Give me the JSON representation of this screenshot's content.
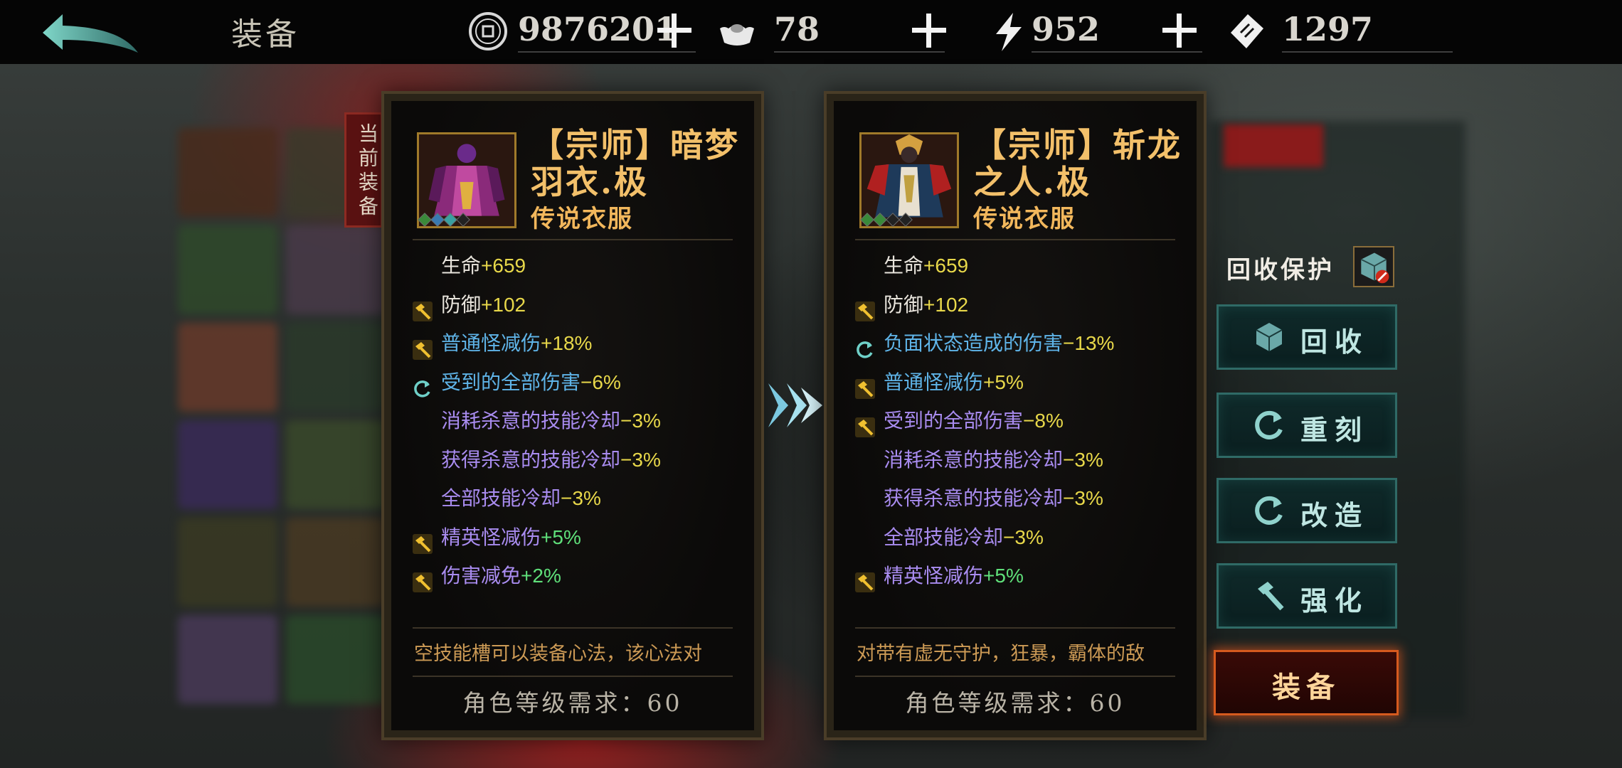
{
  "header": {
    "title": "装备",
    "resources": [
      {
        "icon": "coin-icon",
        "value": "9876201"
      },
      {
        "icon": "silver-ingot-icon",
        "value": "78"
      },
      {
        "icon": "stamina-lightning-icon",
        "value": "952"
      },
      {
        "icon": "ticket-icon",
        "value": "1297"
      }
    ]
  },
  "current_tag": "当前装备",
  "cards": [
    {
      "name": "【宗师】暗梦羽衣.极",
      "type": "传说衣服",
      "stats": [
        {
          "icon": "",
          "label": "生命",
          "value": "+659",
          "label_color": "white",
          "value_color": "yellow"
        },
        {
          "icon": "hammer-icon",
          "label": "防御",
          "value": "+102",
          "label_color": "white",
          "value_color": "yellow"
        },
        {
          "icon": "hammer-icon",
          "label": "普通怪减伤",
          "value": "+18%",
          "label_color": "blue",
          "value_color": "yellow"
        },
        {
          "icon": "refresh-icon",
          "label": "受到的全部伤害",
          "value": "−6%",
          "label_color": "blue",
          "value_color": "yellow"
        },
        {
          "icon": "",
          "label": "消耗杀意的技能冷却",
          "value": "−3%",
          "label_color": "purple",
          "value_color": "yellow"
        },
        {
          "icon": "",
          "label": "获得杀意的技能冷却",
          "value": "−3%",
          "label_color": "purple",
          "value_color": "yellow"
        },
        {
          "icon": "",
          "label": "全部技能冷却",
          "value": "−3%",
          "label_color": "purple",
          "value_color": "yellow"
        },
        {
          "icon": "hammer-icon",
          "label": "精英怪减伤",
          "value": "+5%",
          "label_color": "purple",
          "value_color": "green"
        },
        {
          "icon": "hammer-icon",
          "label": "伤害减免",
          "value": "+2%",
          "label_color": "purple",
          "value_color": "green"
        }
      ],
      "description": "空技能槽可以装备心法，该心法对",
      "requirement": "角色等级需求：60"
    },
    {
      "name": "【宗师】斩龙之人.极",
      "type": "传说衣服",
      "stats": [
        {
          "icon": "",
          "label": "生命",
          "value": "+659",
          "label_color": "white",
          "value_color": "yellow"
        },
        {
          "icon": "hammer-icon",
          "label": "防御",
          "value": "+102",
          "label_color": "white",
          "value_color": "yellow"
        },
        {
          "icon": "refresh-icon",
          "label": "负面状态造成的伤害",
          "value": "−13%",
          "label_color": "blue",
          "value_color": "yellow"
        },
        {
          "icon": "hammer-icon",
          "label": "普通怪减伤",
          "value": "+5%",
          "label_color": "blue",
          "value_color": "yellow"
        },
        {
          "icon": "hammer-icon",
          "label": "受到的全部伤害",
          "value": "−8%",
          "label_color": "purple",
          "value_color": "yellow"
        },
        {
          "icon": "",
          "label": "消耗杀意的技能冷却",
          "value": "−3%",
          "label_color": "purple",
          "value_color": "yellow"
        },
        {
          "icon": "",
          "label": "获得杀意的技能冷却",
          "value": "−3%",
          "label_color": "purple",
          "value_color": "yellow"
        },
        {
          "icon": "",
          "label": "全部技能冷却",
          "value": "−3%",
          "label_color": "purple",
          "value_color": "yellow"
        },
        {
          "icon": "hammer-icon",
          "label": "精英怪减伤",
          "value": "+5%",
          "label_color": "purple",
          "value_color": "green"
        }
      ],
      "description": "对带有虚无守护，狂暴，霸体的敌",
      "requirement": "角色等级需求：60"
    }
  ],
  "actions": {
    "protect_label": "回收保护",
    "recycle": "回收",
    "reforge": "重刻",
    "modify": "改造",
    "enhance": "强化",
    "equip": "装备"
  },
  "colors": {
    "accent_gold": "#f3c06a",
    "button_teal": "#2f6a66",
    "equip_orange": "#d65a1e"
  }
}
